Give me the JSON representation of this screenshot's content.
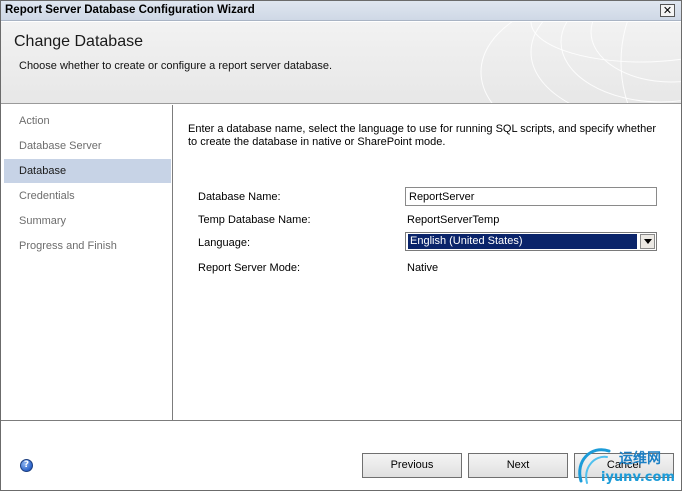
{
  "window": {
    "title": "Report Server Database Configuration Wizard",
    "close_glyph": "✕"
  },
  "header": {
    "title": "Change Database",
    "subtitle": "Choose whether to create or configure a report server database."
  },
  "nav": {
    "items": [
      {
        "label": "Action",
        "active": false
      },
      {
        "label": "Database Server",
        "active": false
      },
      {
        "label": "Database",
        "active": true
      },
      {
        "label": "Credentials",
        "active": false
      },
      {
        "label": "Summary",
        "active": false
      },
      {
        "label": "Progress and Finish",
        "active": false
      }
    ]
  },
  "content": {
    "intro": "Enter a database name, select the language to use for running SQL scripts, and specify whether to create the database in native or SharePoint mode.",
    "db_name_label": "Database Name:",
    "db_name_value": "ReportServer",
    "temp_db_label": "Temp Database Name:",
    "temp_db_value": "ReportServerTemp",
    "language_label": "Language:",
    "language_value": "English (United States)",
    "mode_label": "Report Server Mode:",
    "mode_value": "Native"
  },
  "footer": {
    "help_icon": "help-icon",
    "previous_label": "Previous",
    "next_label": "Next",
    "cancel_label": "Cancel"
  },
  "watermark": {
    "text_cn": "运维网",
    "text_url": "iyunv.com"
  },
  "colors": {
    "nav_active_bg": "#c7d3e6",
    "select_highlight": "#0a246a",
    "titlebar": "#dfe6f0"
  }
}
